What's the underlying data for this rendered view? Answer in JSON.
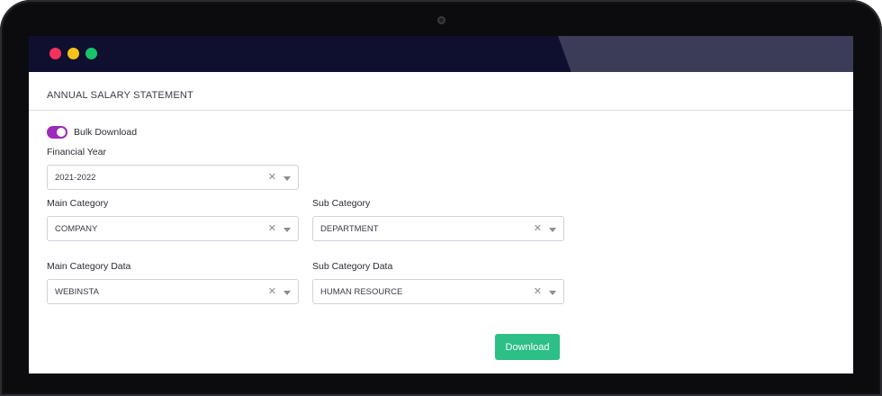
{
  "window": {
    "controls": [
      "close",
      "minimize",
      "maximize"
    ]
  },
  "panel": {
    "title": "ANNUAL SALARY STATEMENT"
  },
  "bulk_download": {
    "label": "Bulk Download",
    "enabled": true
  },
  "fields": {
    "financial_year": {
      "label": "Financial Year",
      "value": "2021-2022"
    },
    "main_category": {
      "label": "Main Category",
      "value": "COMPANY"
    },
    "sub_category": {
      "label": "Sub Category",
      "value": "DEPARTMENT"
    },
    "main_category_data": {
      "label": "Main Category Data",
      "value": "WEBINSTA"
    },
    "sub_category_data": {
      "label": "Sub Category Data",
      "value": "HUMAN RESOURCE"
    }
  },
  "actions": {
    "download_label": "Download"
  },
  "colors": {
    "titlebar": "#0f1030",
    "toggle_on": "#9b2bb8",
    "download_button": "#2cbf86",
    "close_dot": "#f5325c",
    "minimize_dot": "#f9c219",
    "maximize_dot": "#18c36b"
  }
}
